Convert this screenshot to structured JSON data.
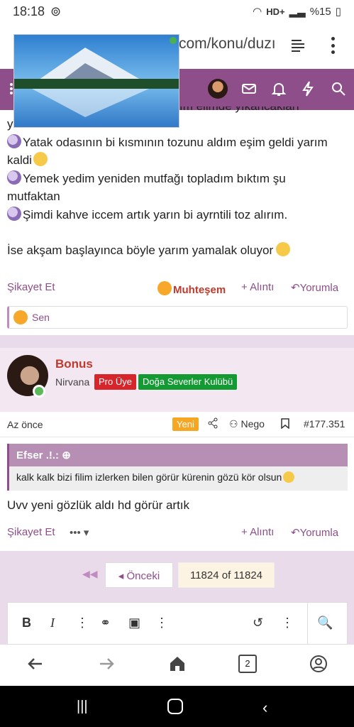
{
  "status_bar": {
    "time": "18:18",
    "network": "HD+",
    "battery": "%15"
  },
  "browser": {
    "url": "com/konu/duzı"
  },
  "post1": {
    "lines": [
      "yıkadım",
      "Yatak odasının bi kısmının tozunu aldım eşim geldi yarım",
      "kaldi",
      "Yemek yedim yeniden mutfağı topladım bıktım şu",
      "mutfaktan",
      "Şimdi kahve iccem artık yarın bi ayrntili toz alırım."
    ],
    "partial_line": "ım elimde yıkancakları",
    "closing": "İse akşam başlayınca böyle yarım yamalak oluyor",
    "report": "Şikayet Et",
    "reaction_label": "Muhteşem",
    "quote_label": "+ Alıntı",
    "reply_label": "Yorumla",
    "reacted_by": "Sen"
  },
  "post2": {
    "author": "Bonus",
    "user_title": "Nirvana",
    "badges": [
      "Pro Üye",
      "Doğa Severler Kulübü"
    ],
    "time": "Az önce",
    "new_label": "Yeni",
    "share_user": "Nego",
    "post_number": "#177.351",
    "quote_author": "Efser .!.:",
    "quote_text": "kalk kalk bizi filim izlerken bilen görür kürenin gözü kör olsun",
    "body": "Uvv yeni gözlük aldı hd görür artık",
    "report": "Şikayet Et",
    "more": "•••",
    "quote_label": "+ Alıntı",
    "reply_label": "Yorumla"
  },
  "pagination": {
    "prev": "Önceki",
    "current": "11824 of 11824"
  },
  "tab_count": "2"
}
